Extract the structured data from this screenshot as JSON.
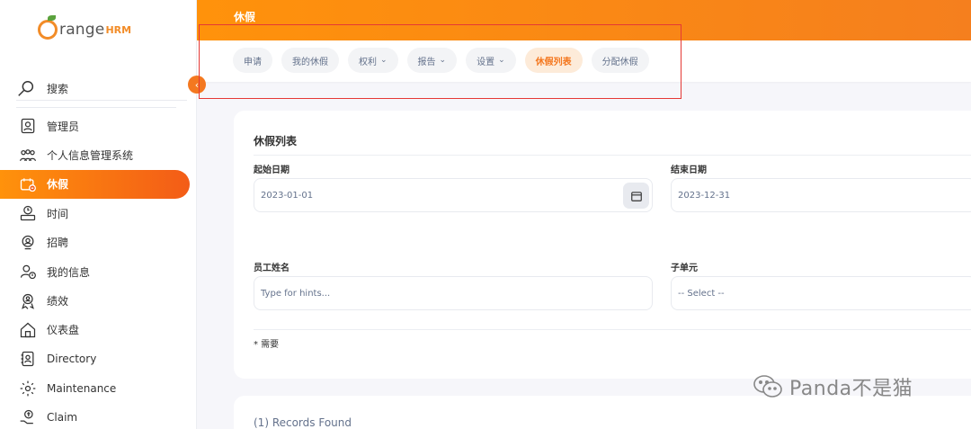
{
  "brand": {
    "name_part1": "range",
    "name_part2": "HRM"
  },
  "sidebar": {
    "search_label": "搜索",
    "items": [
      {
        "label": "管理员",
        "icon": "admin-icon"
      },
      {
        "label": "个人信息管理系统",
        "icon": "pim-icon"
      },
      {
        "label": "休假",
        "icon": "leave-icon",
        "active": true
      },
      {
        "label": "时间",
        "icon": "time-icon"
      },
      {
        "label": "招聘",
        "icon": "recruitment-icon"
      },
      {
        "label": "我的信息",
        "icon": "my-info-icon"
      },
      {
        "label": "绩效",
        "icon": "performance-icon"
      },
      {
        "label": "仪表盘",
        "icon": "dashboard-icon"
      },
      {
        "label": "Directory",
        "icon": "directory-icon"
      },
      {
        "label": "Maintenance",
        "icon": "maintenance-icon"
      },
      {
        "label": "Claim",
        "icon": "claim-icon"
      }
    ]
  },
  "header": {
    "title": "休假"
  },
  "tabs": [
    {
      "label": "申请"
    },
    {
      "label": "我的休假"
    },
    {
      "label": "权利",
      "dropdown": true
    },
    {
      "label": "报告",
      "dropdown": true
    },
    {
      "label": "设置",
      "dropdown": true
    },
    {
      "label": "休假列表",
      "active": true
    },
    {
      "label": "分配休假"
    }
  ],
  "filter": {
    "title": "休假列表",
    "from_label": "起始日期",
    "from_value": "2023-01-01",
    "to_label": "结束日期",
    "to_value": "2023-12-31",
    "employee_label": "员工姓名",
    "employee_placeholder": "Type for hints...",
    "subunit_label": "子单元",
    "subunit_value": "-- Select --",
    "required_note": "* 需要"
  },
  "records": {
    "text": "(1) Records Found"
  },
  "watermark": {
    "text": "Panda不是猫"
  },
  "colors": {
    "accent": "#f47820",
    "active_tab_bg": "#fdebd9",
    "highlight_box": "#e53935"
  }
}
